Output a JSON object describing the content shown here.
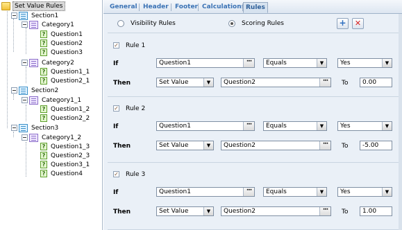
{
  "tree": {
    "root": "Set Value Rules",
    "section1": "Section1",
    "category1": "Category1",
    "q1": "Question1",
    "q2": "Question2",
    "q3": "Question3",
    "category2": "Category2",
    "q1_1": "Question1_1",
    "q2_1": "Question2_1",
    "section2": "Section2",
    "category1_1": "Category1_1",
    "q1_2": "Question1_2",
    "q2_2": "Question2_2",
    "section3": "Section3",
    "category1_2": "Category1_2",
    "q1_3": "Question1_3",
    "q2_3": "Question2_3",
    "q3_1": "Question3_1",
    "q4": "Question4"
  },
  "tabs": [
    "General",
    "Header",
    "Footer",
    "Calculations",
    "Rules"
  ],
  "active_tab": "Rules",
  "toolbar": {
    "visibility_label": "Visibility Rules",
    "scoring_label": "Scoring Rules",
    "selected": "Scoring Rules",
    "add_symbol": "+",
    "delete_symbol": "✕"
  },
  "labels": {
    "if": "If",
    "then": "Then",
    "to": "To",
    "ellipsis": "···",
    "dropdown": "▼"
  },
  "rules": [
    {
      "title": "Rule 1",
      "if_question": "Question1",
      "operator": "Equals",
      "answer": "Yes",
      "action": "Set Value",
      "target": "Question2",
      "value": "0.00"
    },
    {
      "title": "Rule 2",
      "if_question": "Question1",
      "operator": "Equals",
      "answer": "Yes",
      "action": "Set Value",
      "target": "Question2",
      "value": "-5.00"
    },
    {
      "title": "Rule 3",
      "if_question": "Question1",
      "operator": "Equals",
      "answer": "Yes",
      "action": "Set Value",
      "target": "Question2",
      "value": "1.00"
    }
  ],
  "colors": {
    "tab_text": "#3b73b5",
    "panel_bg": "#eaf0f7",
    "add_icon": "#2f6fc0",
    "delete_icon": "#d62020"
  }
}
